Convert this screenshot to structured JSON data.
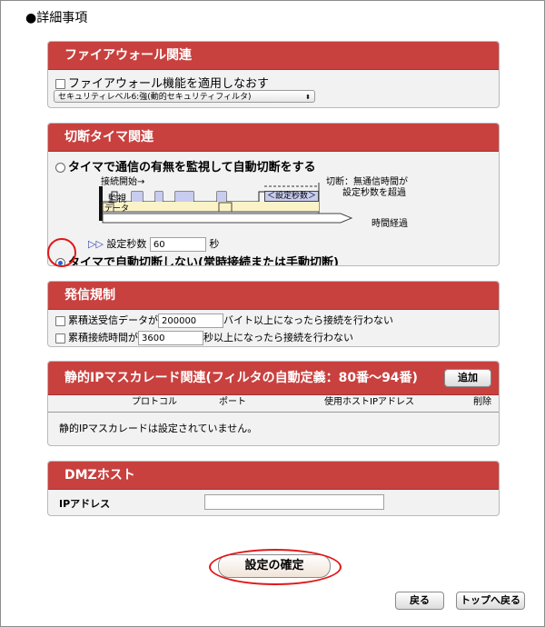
{
  "page": {
    "title": "●詳細事項"
  },
  "firewall": {
    "header": "ファイアウォール関連",
    "reapply_label": "ファイアウォール機能を適用しなおす",
    "security_level": "セキュリティレベル6:強(動的セキュリティフィルタ)"
  },
  "disconnect_timer": {
    "header": "切断タイマ関連",
    "option_monitor": "タイマで通信の有無を監視して自動切断をする",
    "diagram": {
      "connect_start": "接続開始→",
      "disconnect_line1": "切断：無通信時間が",
      "disconnect_line2": "設定秒数を超過",
      "monitor": "監視",
      "data": "データ",
      "set_seconds": "＜設定秒数＞",
      "elapsed": "時間経過"
    },
    "seconds_label": "設定秒数",
    "seconds_value": "60",
    "seconds_unit": "秒",
    "option_no_timer": "タイマで自動切断しない(常時接続または手動切断)"
  },
  "outgoing_limit": {
    "header": "発信規制",
    "data_prefix": "累積送受信データが",
    "data_value": "200000",
    "data_suffix": "バイト以上になったら接続を行わない",
    "time_prefix": "累積接続時間が",
    "time_value": "3600",
    "time_suffix": "秒以上になったら接続を行わない"
  },
  "static_ip": {
    "header": "静的IPマスカレード関連(フィルタの自動定義：80番〜94番)",
    "add_button": "追加",
    "columns": [
      "プロトコル",
      "ポート",
      "使用ホストIPアドレス",
      "削除"
    ],
    "empty_message": "静的IPマスカレードは設定されていません。"
  },
  "dmz": {
    "header": "DMZホスト",
    "ip_label": "IPアドレス",
    "ip_value": ""
  },
  "actions": {
    "confirm": "設定の確定",
    "back": "戻る",
    "top": "トップへ戻る"
  }
}
